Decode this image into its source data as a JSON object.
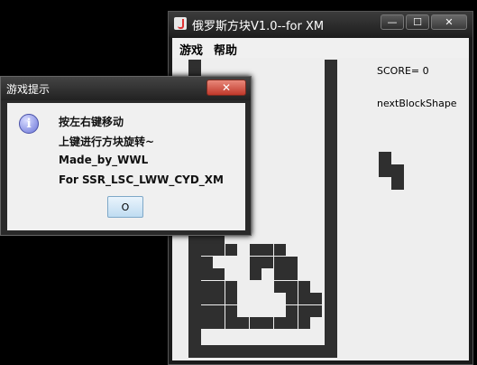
{
  "main_window": {
    "title": "俄罗斯方块V1.0--for XM",
    "controls": {
      "minimize": "—",
      "maximize": "☐",
      "close": "✕"
    }
  },
  "menu": {
    "items": [
      "游戏",
      "帮助"
    ]
  },
  "game": {
    "score_text": "SCORE= 0",
    "next_label": "nextBlockShape"
  },
  "dialog": {
    "title": "游戏提示",
    "close": "✕",
    "icon": "info-icon",
    "lines": [
      "按左右键移动",
      "上键进行方块旋转~",
      "Made_by_WWL",
      "For SSR_LSC_LWW_CYD_XM"
    ],
    "ok_label": "O"
  }
}
